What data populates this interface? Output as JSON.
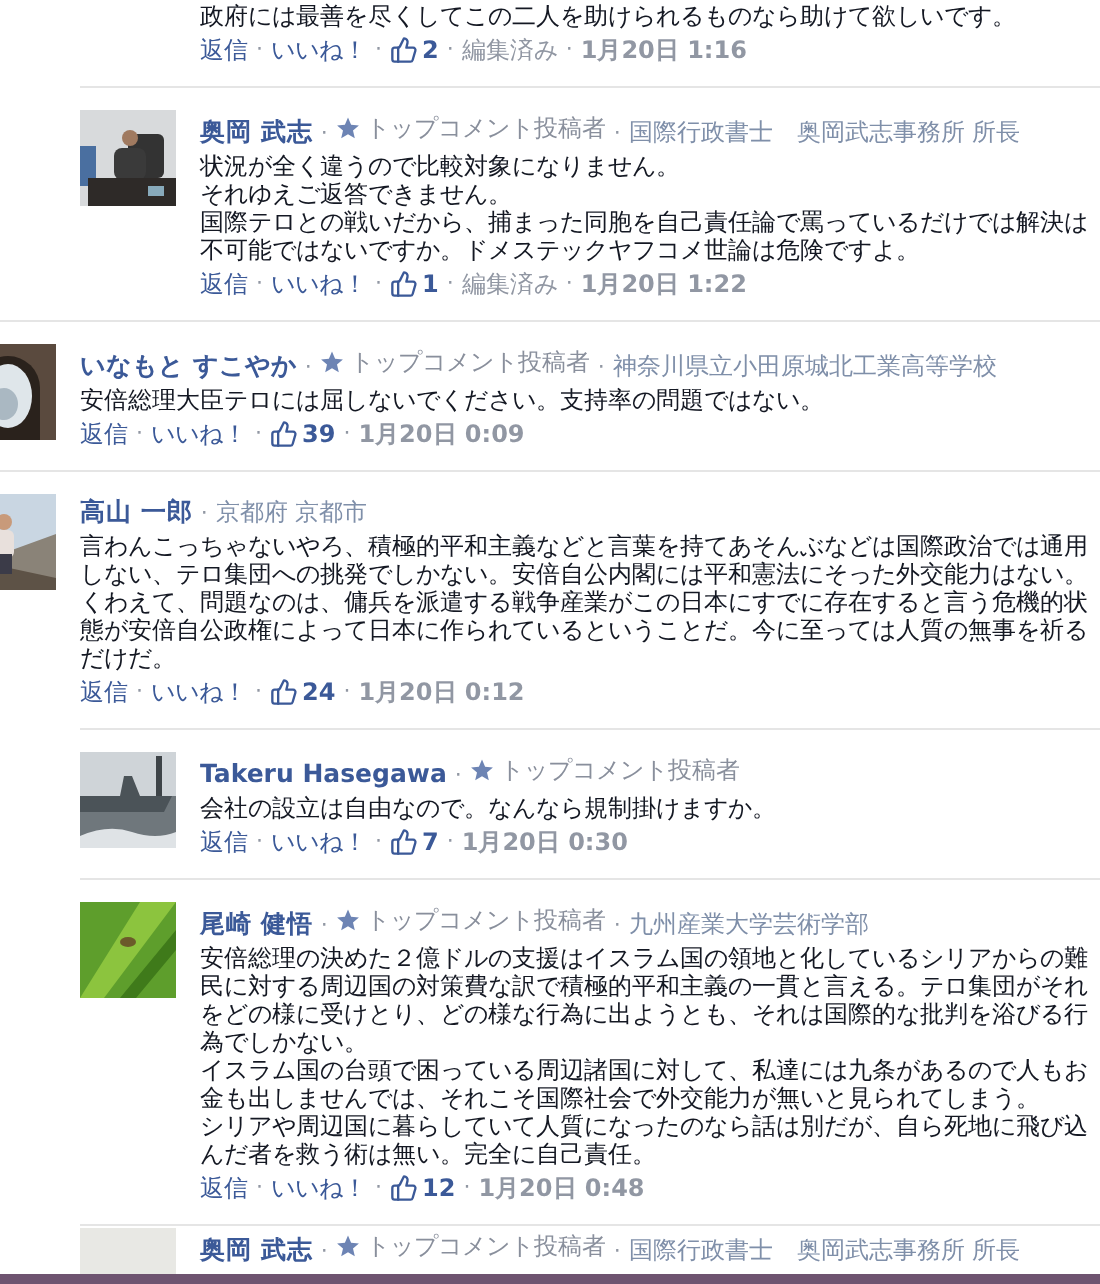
{
  "separator": "·",
  "comments": [
    {
      "kind": "reply",
      "lines": [
        "政府には最善を尽くしてこの二人を助けられるものなら助けて欲しいです。"
      ],
      "reply": "返信",
      "like": "いいね！",
      "likes": "2",
      "edited": "編集済み",
      "time": "1月20日 1:16"
    },
    {
      "kind": "reply",
      "author": "奥岡 武志",
      "badge": "トップコメント投稿者",
      "affiliation": "国際行政書士　奥岡武志事務所 所長",
      "lines": [
        "状況が全く違うので比較対象になりません。",
        "それゆえご返答できません。",
        "国際テロとの戦いだから、捕まった同胞を自己責任論で罵っているだけでは解決は不可能ではないですか。ドメステックヤフコメ世論は危険ですよ。"
      ],
      "reply": "返信",
      "like": "いいね！",
      "likes": "1",
      "edited": "編集済み",
      "time": "1月20日 1:22"
    },
    {
      "kind": "comment",
      "author": "いなもと すこやか",
      "badge": "トップコメント投稿者",
      "affiliation": "神奈川県立小田原城北工業高等学校",
      "lines": [
        "安倍総理大臣テロには屈しないでください。支持率の問題ではない。"
      ],
      "reply": "返信",
      "like": "いいね！",
      "likes": "39",
      "time": "1月20日 0:09"
    },
    {
      "kind": "comment",
      "author": "高山 一郎",
      "affiliation": "京都府 京都市",
      "lines": [
        "言わんこっちゃないやろ、積極的平和主義などと言葉を持てあそんぶなどは国際政治では通用しない、テロ集団への挑発でしかない。安倍自公内閣には平和憲法にそった外交能力はない。くわえて、問題なのは、傭兵を派遣する戦争産業がこの日本にすでに存在すると言う危機的状態が安倍自公政権によって日本に作られているということだ。今に至っては人質の無事を祈るだけだ。"
      ],
      "reply": "返信",
      "like": "いいね！",
      "likes": "24",
      "time": "1月20日 0:12"
    },
    {
      "kind": "reply",
      "author": "Takeru Hasegawa",
      "badge": "トップコメント投稿者",
      "lines": [
        "会社の設立は自由なので。なんなら規制掛けますか。"
      ],
      "reply": "返信",
      "like": "いいね！",
      "likes": "7",
      "time": "1月20日 0:30"
    },
    {
      "kind": "reply",
      "author": "尾崎 健悟",
      "badge": "トップコメント投稿者",
      "affiliation": "九州産業大学芸術学部",
      "lines": [
        "安倍総理の決めた２億ドルの支援はイスラム国の領地と化しているシリアからの難民に対する周辺国の対策費な訳で積極的平和主義の一貫と言える。テロ集団がそれをどの様に受けとり、どの様な行為に出ようとも、それは国際的な批判を浴びる行為でしかない。",
        "イスラム国の台頭で困っている周辺諸国に対して、私達には九条があるので人もお金も出しませんでは、それこそ国際社会で外交能力が無いと見られてしまう。",
        "シリアや周辺国に暮らしていて人質になったのなら話は別だが、自ら死地に飛び込んだ者を救う術は無い。完全に自己責任。"
      ],
      "reply": "返信",
      "like": "いいね！",
      "likes": "12",
      "time": "1月20日 0:48"
    },
    {
      "kind": "reply",
      "author": "奥岡 武志",
      "badge": "トップコメント投稿者",
      "affiliation": "国際行政書士　奥岡武志事務所 所長"
    }
  ]
}
